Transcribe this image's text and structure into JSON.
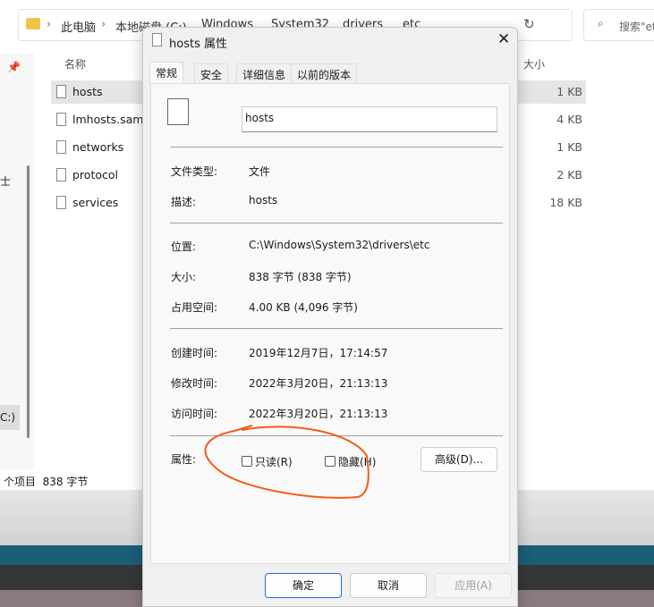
{
  "explorer": {
    "breadcrumb": [
      "此电脑",
      "本地磁盘 (C:)",
      "Windows",
      "System32",
      "drivers",
      "etc"
    ],
    "search_placeholder": "搜索\"etc\"",
    "col_name": "名称",
    "col_size": "大小",
    "files": [
      {
        "name": "hosts",
        "size": "1 KB"
      },
      {
        "name": "lmhosts.sam",
        "size": "4 KB"
      },
      {
        "name": "networks",
        "size": "1 KB"
      },
      {
        "name": "protocol",
        "size": "2 KB"
      },
      {
        "name": "services",
        "size": "18 KB"
      }
    ],
    "sidebar_fragments": [
      "士",
      "C:)"
    ],
    "status": "个项目  838 字节"
  },
  "dialog": {
    "title": "hosts 属性",
    "tabs": [
      "常规",
      "安全",
      "详细信息",
      "以前的版本"
    ],
    "filename": "hosts",
    "fields": [
      {
        "label": "文件类型:",
        "value": "文件"
      },
      {
        "label": "描述:",
        "value": "hosts"
      },
      {
        "label": "位置:",
        "value": "C:\\Windows\\System32\\drivers\\etc"
      },
      {
        "label": "大小:",
        "value": "838 字节 (838 字节)"
      },
      {
        "label": "占用空间:",
        "value": "4.00 KB (4,096 字节)"
      },
      {
        "label": "创建时间:",
        "value": "2019年12月7日，17:14:57"
      },
      {
        "label": "修改时间:",
        "value": "2022年3月20日，21:13:13"
      },
      {
        "label": "访问时间:",
        "value": "2022年3月20日，21:13:13"
      }
    ],
    "attributes_label": "属性:",
    "readonly": {
      "label": "只读(R)",
      "checked": false
    },
    "hidden": {
      "label": "隐藏(H)",
      "checked": false
    },
    "advanced": "高级(D)...",
    "ok": "确定",
    "cancel": "取消",
    "apply": "应用(A)"
  },
  "annotation_color": "#f25c19"
}
